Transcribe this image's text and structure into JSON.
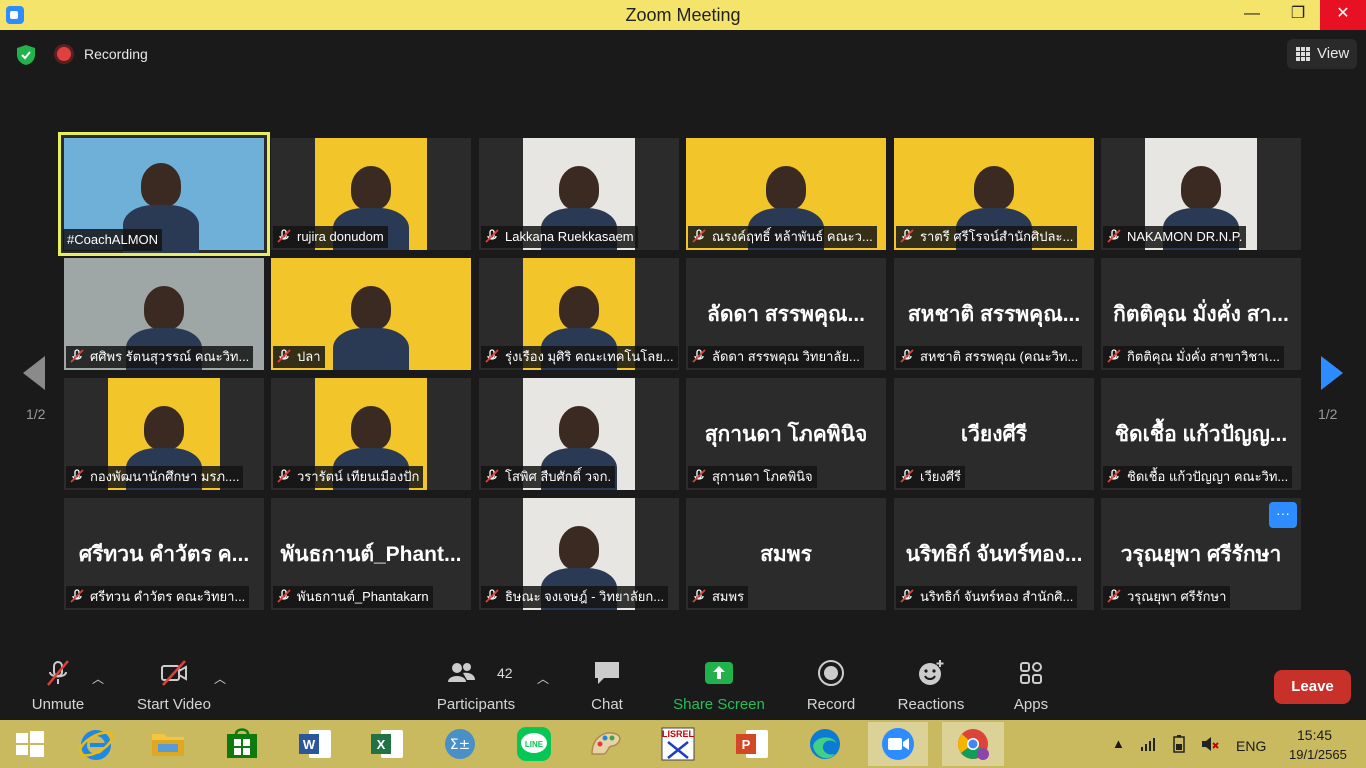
{
  "window": {
    "title": "Zoom Meeting",
    "minimize": "—",
    "maximize": "❐",
    "close": "✕"
  },
  "topbar": {
    "recording_label": "Recording",
    "view_label": "View"
  },
  "participants": [
    {
      "label": "#CoachALMON",
      "muted": false,
      "video": "coach",
      "active": true
    },
    {
      "label": "rujira donudom",
      "muted": true,
      "video": "yellow"
    },
    {
      "label": "Lakkana Ruekkasaem",
      "muted": true,
      "video": "light"
    },
    {
      "label": "ณรงค์ฤทธิ์ หล้าพันธ์ คณะว...",
      "muted": true,
      "video": "yellow"
    },
    {
      "label": "ราตรี   ศรีโรจน์สำนักศิปละ...",
      "muted": true,
      "video": "yellow"
    },
    {
      "label": "NAKAMON DR.N.P.",
      "muted": true,
      "video": "light"
    },
    {
      "label": "ศศิพร รัตนสุวรรณ์ คณะวิท...",
      "muted": true,
      "video": "gray"
    },
    {
      "label": "ปลา",
      "muted": true,
      "video": "yellow"
    },
    {
      "label": "รุ่งเรือง มุศิริ คณะเทคโนโลย...",
      "muted": true,
      "video": "yellow"
    },
    {
      "label": "ลัดดา สรรพคุณ  วิทยาลัย...",
      "muted": true,
      "bigname": "ลัดดา สรรพคุณ..."
    },
    {
      "label": "สหชาติ สรรพคุณ (คณะวิท...",
      "muted": true,
      "bigname": "สหชาติ สรรพคุณ..."
    },
    {
      "label": "กิตติคุณ  มั่งคั่ง สาขาวิชาเ...",
      "muted": true,
      "bigname": "กิตติคุณ  มั่งคั่ง สา..."
    },
    {
      "label": "กองพัฒนานักศึกษา มรภ....",
      "muted": true,
      "video": "yellow"
    },
    {
      "label": "วรารัตน์ เทียนเมืองปัก",
      "muted": true,
      "video": "yellow"
    },
    {
      "label": "โสพิศ สืบศักดิ์ วจก.",
      "muted": true,
      "video": "light"
    },
    {
      "label": "สุกานดา โภคพินิจ",
      "muted": true,
      "bigname": "สุกานดา โภคพินิจ"
    },
    {
      "label": "เวียงศีรี",
      "muted": true,
      "bigname": "เวียงศีรี"
    },
    {
      "label": "ชิดเชื้อ แก้วปัญญา คณะวิท...",
      "muted": true,
      "bigname": "ชิดเชื้อ แก้วปัญญ..."
    },
    {
      "label": "ศรีทวน  คำวัตร คณะวิทยา...",
      "muted": true,
      "bigname": "ศรีทวน  คำวัตร ค..."
    },
    {
      "label": "พันธกานต์_Phantakarn",
      "muted": true,
      "bigname": "พันธกานต์_Phant..."
    },
    {
      "label": "ธิษณะ จงเจษฎ์ - วิทยาลัยก...",
      "muted": true,
      "video": "light"
    },
    {
      "label": "สมพร",
      "muted": true,
      "bigname": "สมพร"
    },
    {
      "label": "นริทธิก์ จันทร์หอง สำนักศิ...",
      "muted": true,
      "bigname": "นริทธิก์ จันทร์ทอง..."
    },
    {
      "label": "วรุณยุพา ศรีรักษา",
      "muted": true,
      "bigname": "วรุณยุพา ศรีรักษา"
    }
  ],
  "pagination": {
    "left": "1/2",
    "right": "1/2",
    "more": "···"
  },
  "toolbar": {
    "unmute": "Unmute",
    "start_video": "Start Video",
    "participants": "Participants",
    "participants_count": "42",
    "chat": "Chat",
    "share_screen": "Share Screen",
    "record": "Record",
    "reactions": "Reactions",
    "apps": "Apps",
    "leave": "Leave"
  },
  "tray": {
    "lang": "ENG",
    "time": "15:45",
    "date": "19/1/2565"
  },
  "colors": {
    "accent": "#2d8cff",
    "share": "#22b24c",
    "leave": "#c8302a",
    "active_border": "#e7f05a",
    "title_bar": "#f5e46c",
    "taskbar": "#c9b95f"
  }
}
